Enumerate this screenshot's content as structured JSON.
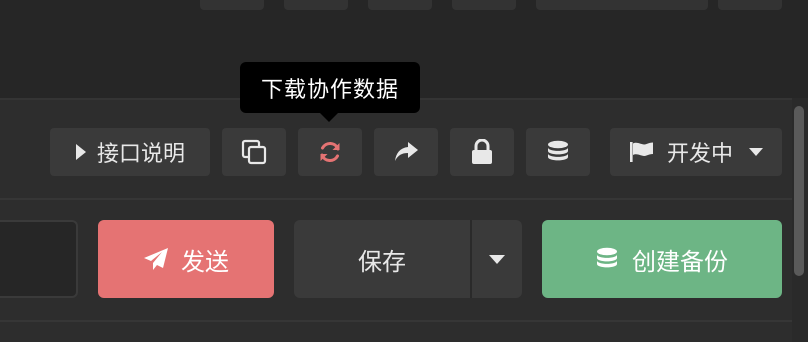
{
  "tooltip": {
    "text": "下载协作数据"
  },
  "toolbar": {
    "api_doc_label": "接口说明",
    "status_label": "开发中",
    "copy_icon": "copy-icon",
    "sync_icon": "sync-icon",
    "share_icon": "share-icon",
    "lock_icon": "lock-icon",
    "database_icon": "database-icon",
    "flag_icon": "flag-icon"
  },
  "actions": {
    "send_label": "发送",
    "save_label": "保存",
    "backup_label": "创建备份"
  },
  "colors": {
    "send": "#e57373",
    "backup": "#6db585",
    "sync_icon": "#e57373",
    "button_bg": "#3a3a3a",
    "panel_bg": "#2d2d2d"
  }
}
